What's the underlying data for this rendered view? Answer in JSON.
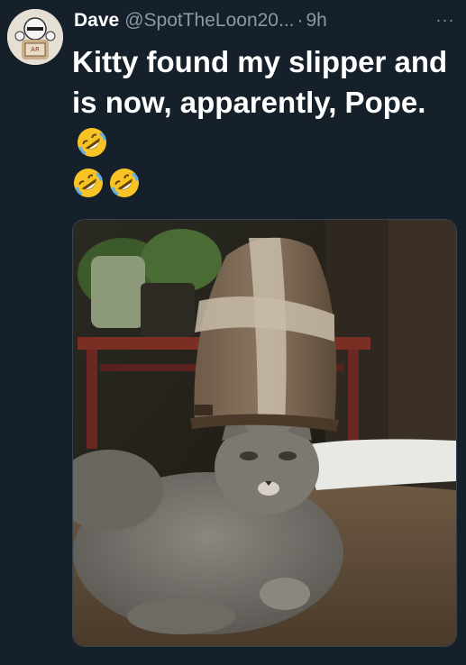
{
  "tweet": {
    "display_name": "Dave",
    "handle": "@SpotTheLoon20...",
    "separator": "·",
    "time": "9h",
    "more_label": "···",
    "text": "Kitty found my slipper and is now, apparently, Pope.",
    "emoji": [
      "rolling-on-floor-laughing",
      "rolling-on-floor-laughing",
      "rolling-on-floor-laughing"
    ]
  },
  "media": {
    "alt": "Gray cat lying down with a slipper on its head like a papal mitre",
    "icon": "photo"
  },
  "colors": {
    "background": "#15202b",
    "secondary_text": "#8b98a5",
    "border": "#38444d"
  }
}
